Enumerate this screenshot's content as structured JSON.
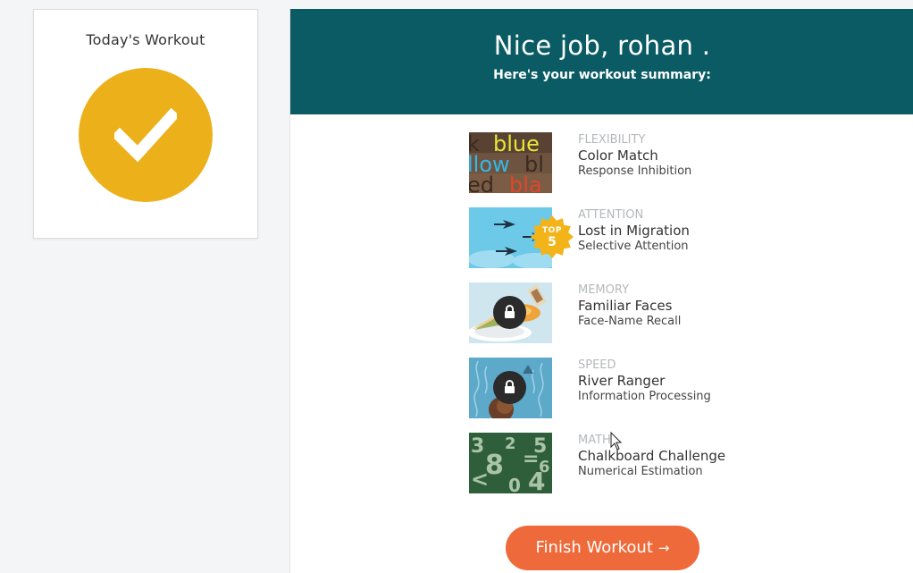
{
  "sidebar": {
    "title": "Today's Workout",
    "status_icon": "check-icon",
    "accent_color": "#ebb01a"
  },
  "header": {
    "title": "Nice job, rohan .",
    "subtitle": "Here's your workout summary:",
    "background_color": "#0a5b63"
  },
  "games": [
    {
      "category": "FLEXIBILITY",
      "name": "Color Match",
      "skill": "Response Inhibition",
      "locked": false,
      "badge": null
    },
    {
      "category": "ATTENTION",
      "name": "Lost in Migration",
      "skill": "Selective Attention",
      "locked": false,
      "badge": {
        "label": "TOP",
        "value": "5"
      }
    },
    {
      "category": "MEMORY",
      "name": "Familiar Faces",
      "skill": "Face-Name Recall",
      "locked": true,
      "badge": null
    },
    {
      "category": "SPEED",
      "name": "River Ranger",
      "skill": "Information Processing",
      "locked": true,
      "badge": null
    },
    {
      "category": "MATH",
      "name": "Chalkboard Challenge",
      "skill": "Numerical Estimation",
      "locked": false,
      "badge": null
    }
  ],
  "thumb_text": {
    "color_match": [
      "k",
      "blue",
      "llow",
      "bl",
      "ed",
      "bla"
    ],
    "chalkboard": [
      "3",
      "2",
      "8",
      "=",
      "5",
      "<",
      "4",
      "0",
      "6"
    ]
  },
  "finish_button": {
    "label": "Finish Workout",
    "arrow": "→",
    "color": "#ef6a3a"
  }
}
